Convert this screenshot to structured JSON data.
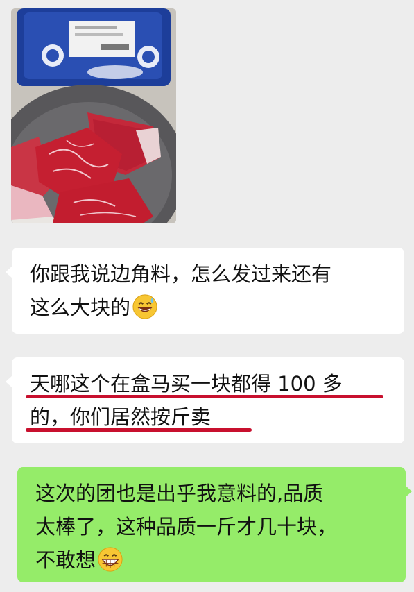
{
  "chat": {
    "photo": {
      "alt": "beef steak photo"
    },
    "messages": [
      {
        "side": "left",
        "lines": [
          "你跟我说边角料，怎么发过来还有",
          "这么大块的"
        ],
        "emoji": "grinning-sweat-face-icon"
      },
      {
        "side": "left",
        "lines": [
          "天哪这个在盒马买一块都得 100 多",
          "的，你们居然按斤卖"
        ],
        "underline_color": "#c8102e"
      },
      {
        "side": "right",
        "lines": [
          "这次的团也是出乎我意料的,品质",
          "太棒了，这种品质一斤才几十块，",
          "不敢想"
        ],
        "emoji": "grinning-face-icon"
      }
    ]
  },
  "colors": {
    "background": "#ededed",
    "left_bubble": "#ffffff",
    "right_bubble": "#95ec69",
    "underline": "#c8102e"
  }
}
